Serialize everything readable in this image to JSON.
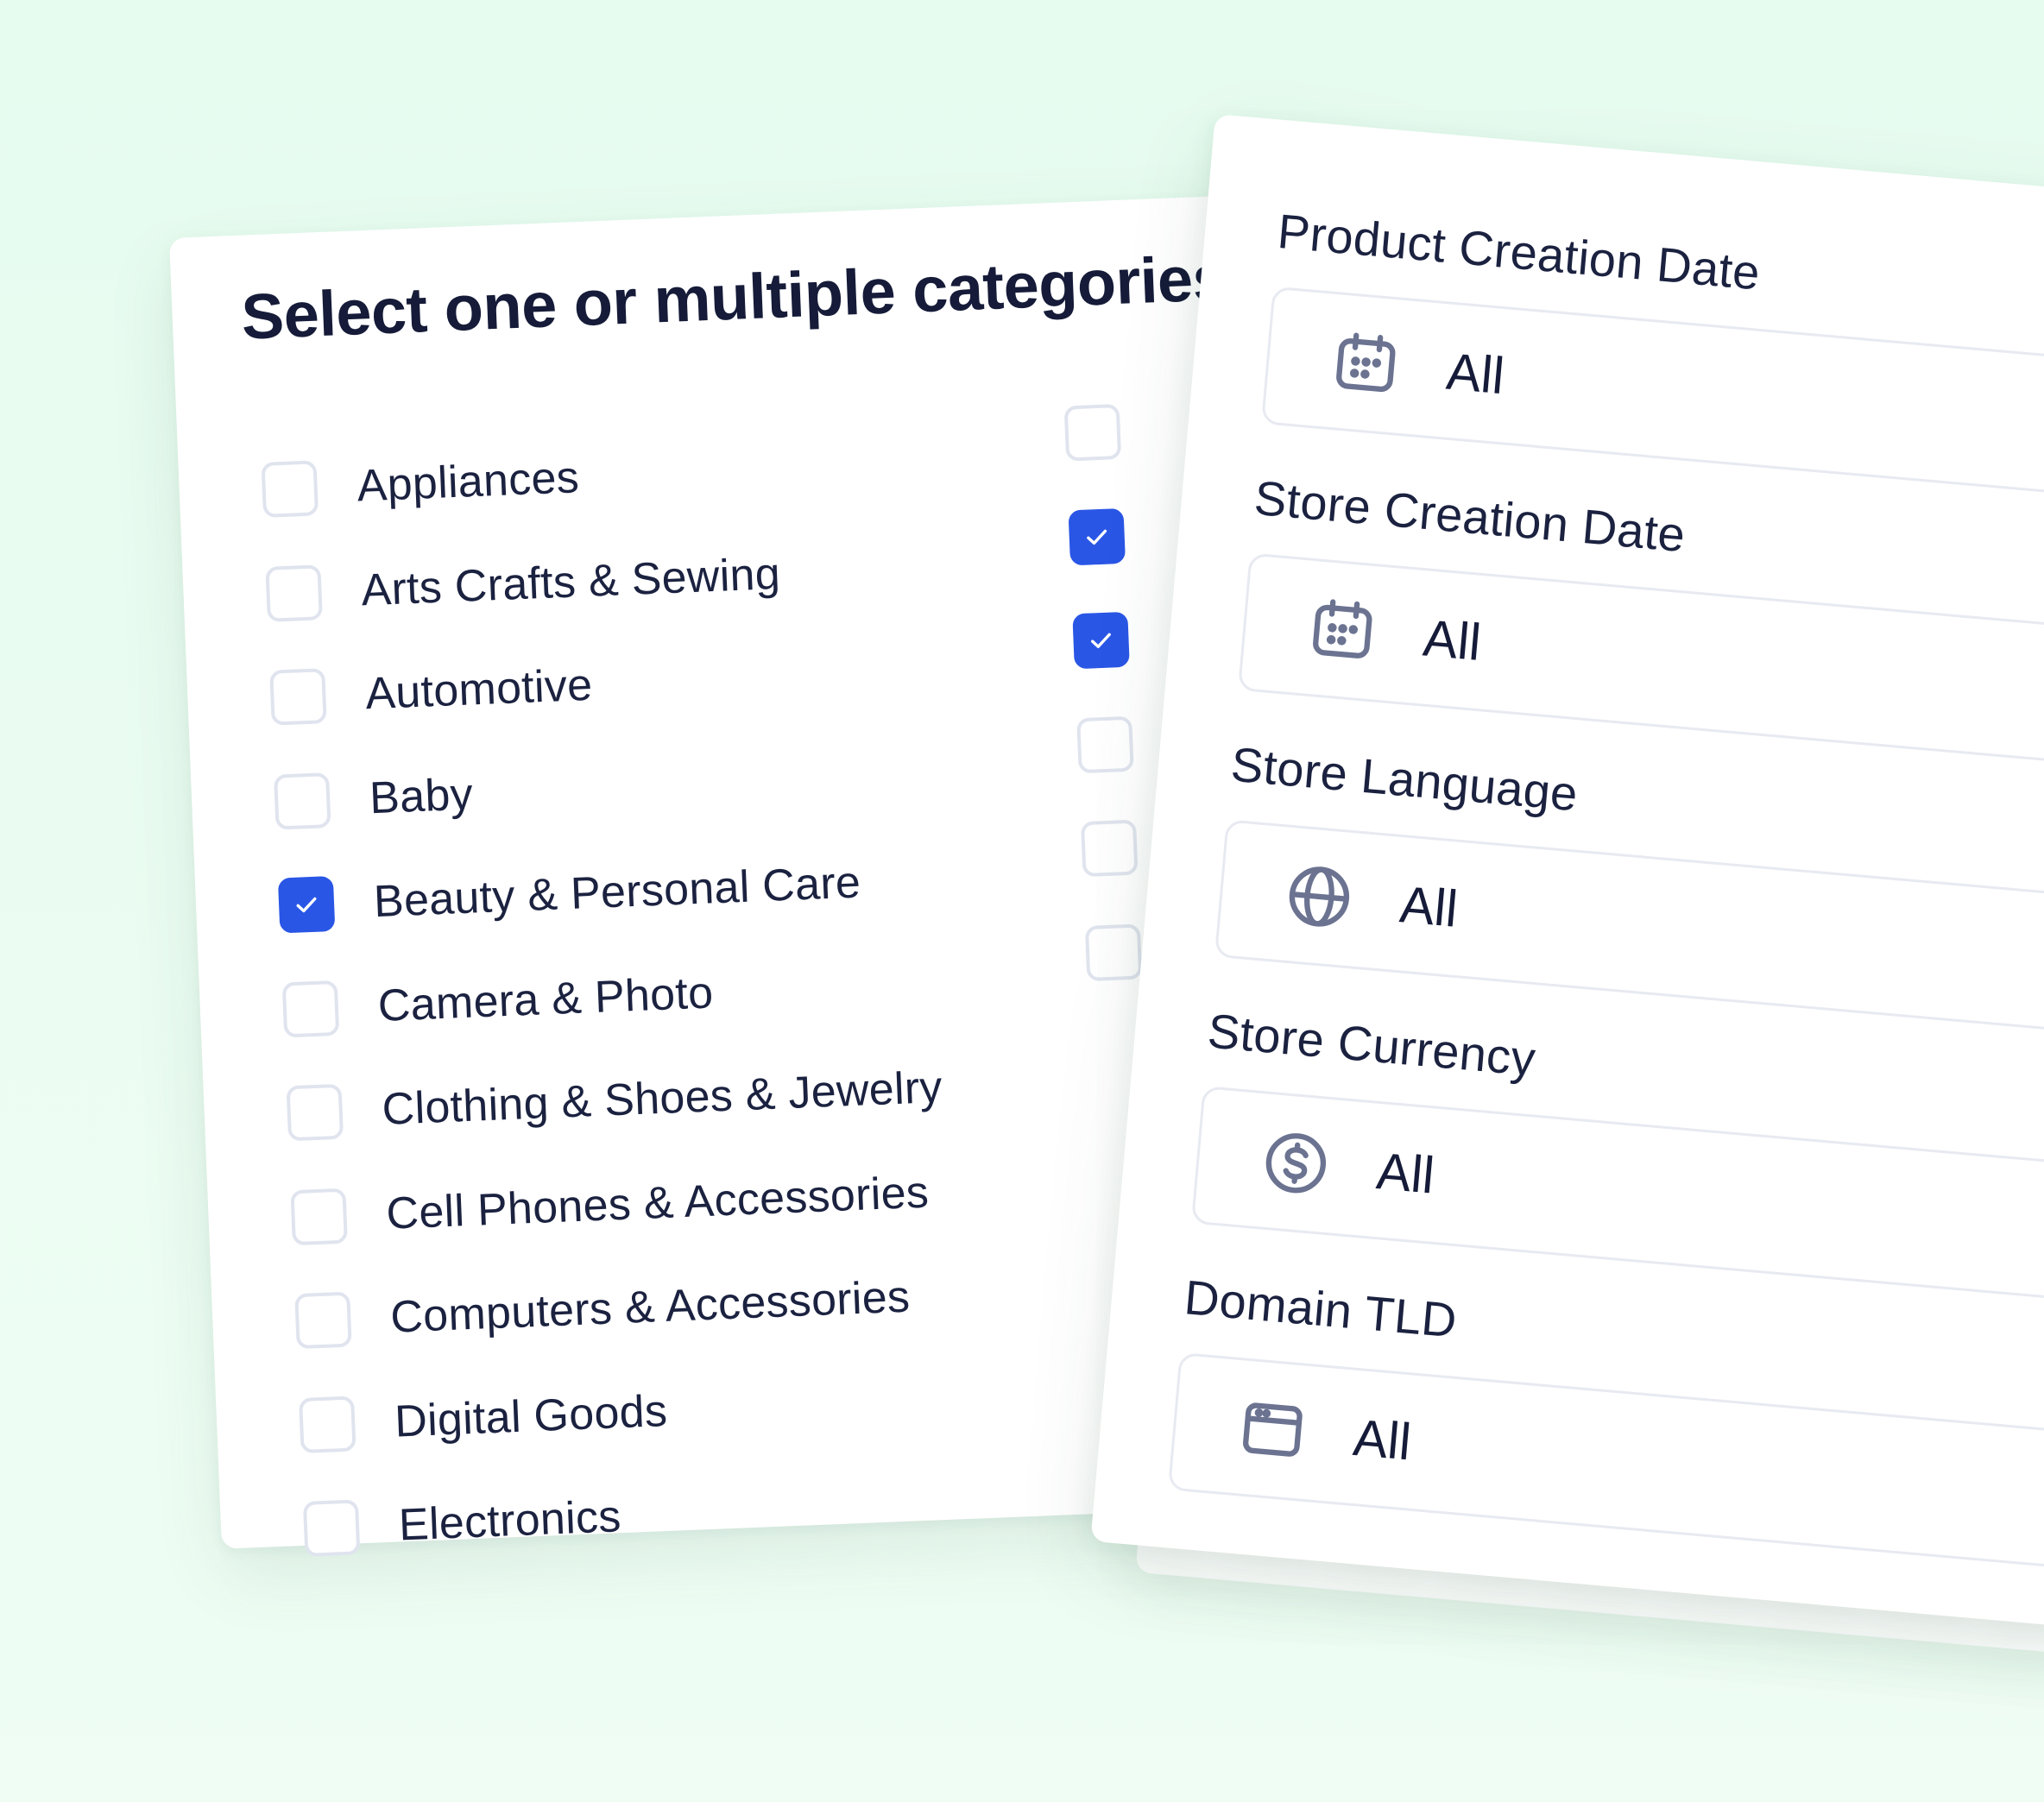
{
  "categories_panel": {
    "title": "Select one or multiple categories",
    "items": [
      {
        "label": "Appliances",
        "checked": false
      },
      {
        "label": "Arts Crafts & Sewing",
        "checked": false
      },
      {
        "label": "Automotive",
        "checked": false
      },
      {
        "label": "Baby",
        "checked": false
      },
      {
        "label": "Beauty & Personal Care",
        "checked": true
      },
      {
        "label": "Camera & Photo",
        "checked": false
      },
      {
        "label": "Clothing & Shoes & Jewelry",
        "checked": false
      },
      {
        "label": "Cell Phones & Accessories",
        "checked": false
      },
      {
        "label": "Computers & Accessories",
        "checked": false
      },
      {
        "label": "Digital Goods",
        "checked": false
      },
      {
        "label": "Electronics",
        "checked": false
      }
    ],
    "second_column_checked": [
      false,
      true,
      true,
      false,
      false,
      false
    ]
  },
  "filters_panel": {
    "filters": [
      {
        "label": "Product Creation Date",
        "value": "All",
        "icon": "calendar-icon"
      },
      {
        "label": "Store Creation Date",
        "value": "All",
        "icon": "calendar-icon"
      },
      {
        "label": "Store Language",
        "value": "All",
        "icon": "globe-icon"
      },
      {
        "label": "Store Currency",
        "value": "All",
        "icon": "dollar-icon"
      },
      {
        "label": "Domain TLD",
        "value": "All",
        "icon": "browser-window-icon"
      }
    ]
  },
  "colors": {
    "background": "#e6fcef",
    "accent": "#2a56e6",
    "text": "#1b2240",
    "icon": "#6b7391",
    "checkbox_border": "#e0e4ee"
  }
}
